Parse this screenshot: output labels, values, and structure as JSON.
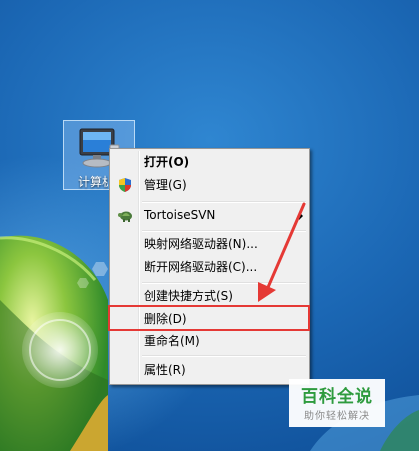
{
  "desktop": {
    "computer_icon_label": "计算机"
  },
  "context_menu": {
    "items": [
      {
        "label": "打开(O)",
        "bold": true
      },
      {
        "label": "管理(G)",
        "icon": "uac-shield-icon"
      },
      {
        "label": "TortoiseSVN",
        "icon": "tortoisesvn-icon",
        "submenu": true
      },
      {
        "label": "映射网络驱动器(N)..."
      },
      {
        "label": "断开网络驱动器(C)..."
      },
      {
        "label": "创建快捷方式(S)"
      },
      {
        "label": "删除(D)",
        "highlighted": true
      },
      {
        "label": "重命名(M)"
      },
      {
        "label": "属性(R)"
      }
    ]
  },
  "annotation": {
    "highlight_color": "#e53935"
  },
  "watermark": {
    "title": "百科全说",
    "subtitle": "助你轻松解决"
  },
  "colors": {
    "menu_bg": "#f0f0f0",
    "desktop_blue": "#1f6fb7",
    "watermark_green": "#2e9b3e"
  }
}
